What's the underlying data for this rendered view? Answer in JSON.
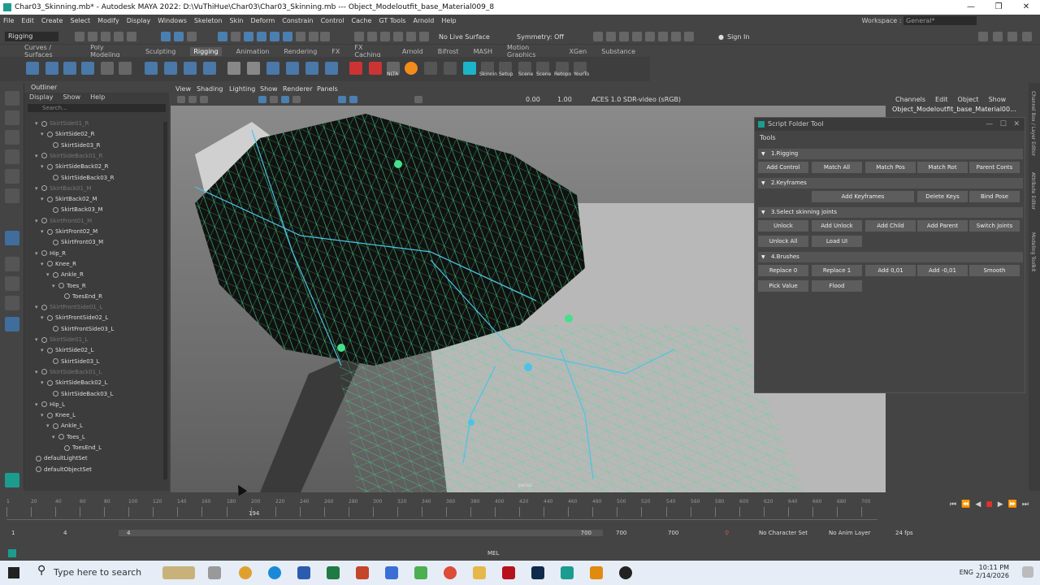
{
  "window": {
    "title": "Char03_Skinning.mb* - Autodesk MAYA 2022: D:\\VuThiHue\\Char03\\Char03_Skinning.mb   ---   Object_Modeloutfit_base_Material009_8",
    "controls": [
      "—",
      "❐",
      "✕"
    ]
  },
  "menubar": [
    "File",
    "Edit",
    "Create",
    "Select",
    "Modify",
    "Display",
    "Windows",
    "Skeleton",
    "Skin",
    "Deform",
    "Constrain",
    "Control",
    "Cache",
    "GT Tools",
    "Arnold",
    "Help"
  ],
  "workspace": {
    "label": "Workspace :",
    "value": "General*"
  },
  "statusline": {
    "mode": "Rigging",
    "live_surface": "No Live Surface",
    "symmetry": "Symmetry: Off",
    "sign_in": "Sign In"
  },
  "shelf": {
    "tabs": [
      "Curves / Surfaces",
      "Poly Modeling",
      "Sculpting",
      "Rigging",
      "Animation",
      "Rendering",
      "FX",
      "FX Caching",
      "Arnold",
      "Bifrost",
      "MASH",
      "Motion Graphics",
      "XGen",
      "Substance"
    ],
    "active_tab": "Rigging",
    "labels": [
      "NLTA",
      "Skinnin",
      "Setup",
      "Scene",
      "Scene",
      "Retopo",
      "YourTo"
    ]
  },
  "outliner": {
    "title": "Outliner",
    "menu": [
      "Display",
      "Show",
      "Help"
    ],
    "search_placeholder": "Search...",
    "items": [
      {
        "label": "SkirtSide01_R",
        "indent": 1,
        "dim": true,
        "exp": true
      },
      {
        "label": "SkirtSide02_R",
        "indent": 2,
        "dim": false,
        "exp": true
      },
      {
        "label": "SkirtSide03_R",
        "indent": 3,
        "dim": false,
        "exp": false
      },
      {
        "label": "SkirtSideBack01_R",
        "indent": 1,
        "dim": true,
        "exp": true
      },
      {
        "label": "SkirtSideBack02_R",
        "indent": 2,
        "dim": false,
        "exp": true
      },
      {
        "label": "SkirtSideBack03_R",
        "indent": 3,
        "dim": false,
        "exp": false
      },
      {
        "label": "SkirtBack01_M",
        "indent": 1,
        "dim": true,
        "exp": true
      },
      {
        "label": "SkirtBack02_M",
        "indent": 2,
        "dim": false,
        "exp": true
      },
      {
        "label": "SkirtBack03_M",
        "indent": 3,
        "dim": false,
        "exp": false
      },
      {
        "label": "SkirtFront01_M",
        "indent": 1,
        "dim": true,
        "exp": true
      },
      {
        "label": "SkirtFront02_M",
        "indent": 2,
        "dim": false,
        "exp": true
      },
      {
        "label": "SkirtFront03_M",
        "indent": 3,
        "dim": false,
        "exp": false
      },
      {
        "label": "Hip_R",
        "indent": 1,
        "dim": false,
        "exp": true
      },
      {
        "label": "Knee_R",
        "indent": 2,
        "dim": false,
        "exp": true
      },
      {
        "label": "Ankle_R",
        "indent": 3,
        "dim": false,
        "exp": true
      },
      {
        "label": "Toes_R",
        "indent": 4,
        "dim": false,
        "exp": true
      },
      {
        "label": "ToesEnd_R",
        "indent": 5,
        "dim": false,
        "exp": false
      },
      {
        "label": "SkirtFrontSide01_L",
        "indent": 1,
        "dim": true,
        "exp": true
      },
      {
        "label": "SkirtFrontSide02_L",
        "indent": 2,
        "dim": false,
        "exp": true
      },
      {
        "label": "SkirtFrontSide03_L",
        "indent": 3,
        "dim": false,
        "exp": false
      },
      {
        "label": "SkirtSide01_L",
        "indent": 1,
        "dim": true,
        "exp": true
      },
      {
        "label": "SkirtSide02_L",
        "indent": 2,
        "dim": false,
        "exp": true
      },
      {
        "label": "SkirtSide03_L",
        "indent": 3,
        "dim": false,
        "exp": false
      },
      {
        "label": "SkirtSideBack01_L",
        "indent": 1,
        "dim": true,
        "exp": true
      },
      {
        "label": "SkirtSideBack02_L",
        "indent": 2,
        "dim": false,
        "exp": true
      },
      {
        "label": "SkirtSideBack03_L",
        "indent": 3,
        "dim": false,
        "exp": false
      },
      {
        "label": "Hip_L",
        "indent": 1,
        "dim": false,
        "exp": true
      },
      {
        "label": "Knee_L",
        "indent": 2,
        "dim": false,
        "exp": true
      },
      {
        "label": "Ankle_L",
        "indent": 3,
        "dim": false,
        "exp": true
      },
      {
        "label": "Toes_L",
        "indent": 4,
        "dim": false,
        "exp": true
      },
      {
        "label": "ToesEnd_L",
        "indent": 5,
        "dim": false,
        "exp": false
      },
      {
        "label": "defaultLightSet",
        "indent": 0,
        "dim": false,
        "exp": false
      },
      {
        "label": "defaultObjectSet",
        "indent": 0,
        "dim": false,
        "exp": false
      }
    ]
  },
  "viewport": {
    "menu": [
      "View",
      "Shading",
      "Lighting",
      "Show",
      "Renderer",
      "Panels"
    ],
    "exposure": "0.00",
    "gamma": "1.00",
    "colorspace": "ACES 1.0 SDR-video (sRGB)",
    "camera": "persp"
  },
  "channelbox": {
    "menu": [
      "Channels",
      "Edit",
      "Object",
      "Show"
    ],
    "object": "Object_Modeloutfit_base_Material00..."
  },
  "sidetabs": [
    "Channel Box / Layer Editor",
    "Attribute Editor",
    "Modeling Toolkit"
  ],
  "script_tool": {
    "title": "Script Folder Tool",
    "tools_label": "Tools",
    "sections": [
      {
        "label": "1.Rigging",
        "rows": [
          [
            "Add Control",
            "Match All",
            "Match Pos",
            "Match Rot",
            "Parent Conts"
          ]
        ]
      },
      {
        "label": "2.Keyframes",
        "rows": [
          [
            "",
            "Add Keyframes",
            "",
            "Delete Keys",
            "Bind Pose"
          ]
        ]
      },
      {
        "label": "3.Select skinning joints",
        "rows": [
          [
            "Unlock",
            "Add Unlock",
            "Add Child",
            "Add Parent",
            "Switch Joints"
          ],
          [
            "Unlock All",
            "Load UI",
            "",
            "",
            ""
          ]
        ]
      },
      {
        "label": "4.Brushes",
        "rows": [
          [
            "Replace 0",
            "Replace 1",
            "Add 0,01",
            "Add -0,01",
            "Smooth"
          ],
          [
            "Pick Value",
            "Flood",
            "",
            "",
            ""
          ]
        ]
      }
    ]
  },
  "timeline": {
    "ticks": [
      "1",
      "20",
      "40",
      "60",
      "80",
      "100",
      "120",
      "140",
      "160",
      "180",
      "200",
      "220",
      "240",
      "260",
      "280",
      "300",
      "320",
      "340",
      "360",
      "380",
      "400",
      "420",
      "440",
      "460",
      "480",
      "500",
      "520",
      "540",
      "560",
      "580",
      "600",
      "620",
      "640",
      "660",
      "680",
      "700"
    ],
    "current_frame": "194",
    "playback": [
      "⏮",
      "⏪",
      "◀",
      "■",
      "▶",
      "⏩",
      "⏭"
    ]
  },
  "range": {
    "start": "1",
    "inner_start": "4",
    "bar_start": "4",
    "bar_end": "700",
    "end1": "700",
    "end2": "700",
    "character_set": "No Character Set",
    "anim_layer": "No Anim Layer",
    "fps": "24 fps"
  },
  "cmdline": {
    "mel": "MEL"
  },
  "taskbar": {
    "search_placeholder": "Type here to search",
    "lang": "ENG",
    "time": "10:11 PM",
    "date": "2/14/2026"
  },
  "colors": {
    "wire_green": "#46e08a",
    "wire_cyan": "#4cc3e6",
    "joint_blue": "#4b9ce6",
    "maya_teal": "#1b9c8f"
  }
}
